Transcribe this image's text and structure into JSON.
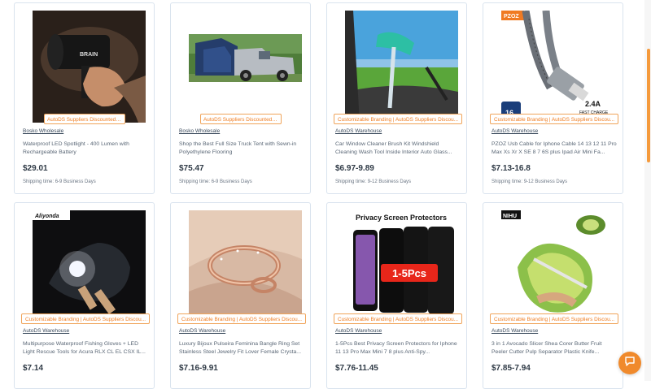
{
  "products": [
    {
      "badge": "AutoDS Suppliers Discounted Prices",
      "supplier": "Bosko Wholesale",
      "title": "Waterproof LED Spotlight - 400 Lumen with Rechargeable Battery",
      "price": "$29.01",
      "shipping": "Shipping time: 6-9 Business Days"
    },
    {
      "badge": "AutoDS Suppliers Discounted Prices",
      "supplier": "Bosko Wholesale",
      "title": "Shop the Best Full Size Truck Tent with Sewn-in Polyethylene Flooring",
      "price": "$75.47",
      "shipping": "Shipping time: 6-9 Business Days"
    },
    {
      "badge": "Customizable Branding | AutoDS Suppliers Discou...",
      "supplier": "AutoDS Warehouse",
      "title": "Car Window Cleaner Brush Kit Windshield Cleaning Wash Tool Inside Interior Auto Glass...",
      "price": "$6.97-9.89",
      "shipping": "Shipping time: 9-12 Business Days"
    },
    {
      "badge": "Customizable Branding | AutoDS Suppliers Discou...",
      "supplier": "AutoDS Warehouse",
      "title": "PZOZ Usb Cable for Iphone Cable 14 13 12 11 Pro Max Xs Xr X SE 8 7 6S plus Ipad Air Mini Fa...",
      "price": "$7.13-16.8",
      "shipping": "Shipping time: 9-12 Business Days",
      "image_text": {
        "brand": "PZOZ",
        "amp": "2.4A",
        "charge": "FAST CHARGE",
        "num": "16"
      }
    },
    {
      "badge": "Customizable Branding | AutoDS Suppliers Discou...",
      "supplier": "AutoDS Warehouse",
      "title": "Multipurpose Waterproof Fishing Gloves + LED Light Rescue Tools for Acura RLX CL EL CSX IL...",
      "price": "$7.14",
      "image_text": {
        "brand": "Aliyonda"
      }
    },
    {
      "badge": "Customizable Branding | AutoDS Suppliers Discou...",
      "supplier": "AutoDS Warehouse",
      "title": "Luxury Bijoux Pulseira Feminina Bangle Ring Set Stainless Steel Jewelry Fit Lover Female Crysta...",
      "price": "$7.16-9.91"
    },
    {
      "badge": "Customizable Branding | AutoDS Suppliers Discou...",
      "supplier": "AutoDS Warehouse",
      "title": "1-5Pcs Best Privacy Screen Protectors for Iphone 11 13 Pro Max Mini 7 8 plus Anti-Spy...",
      "price": "$7.76-11.45",
      "image_text": {
        "headline": "Privacy Screen Protectors",
        "pcs": "1-5Pcs"
      }
    },
    {
      "badge": "Customizable Branding | AutoDS Suppliers Discou...",
      "supplier": "AutoDS Warehouse",
      "title": "3 in 1 Avocado Slicer Shea Corer Butter Fruit Peeler Cutter Pulp Separator Plastic Knife...",
      "price": "$7.85-7.94",
      "image_text": {
        "brand": "NIHU"
      }
    }
  ],
  "colors": {
    "accent": "#ef7d22",
    "border": "#d9e3ee"
  }
}
